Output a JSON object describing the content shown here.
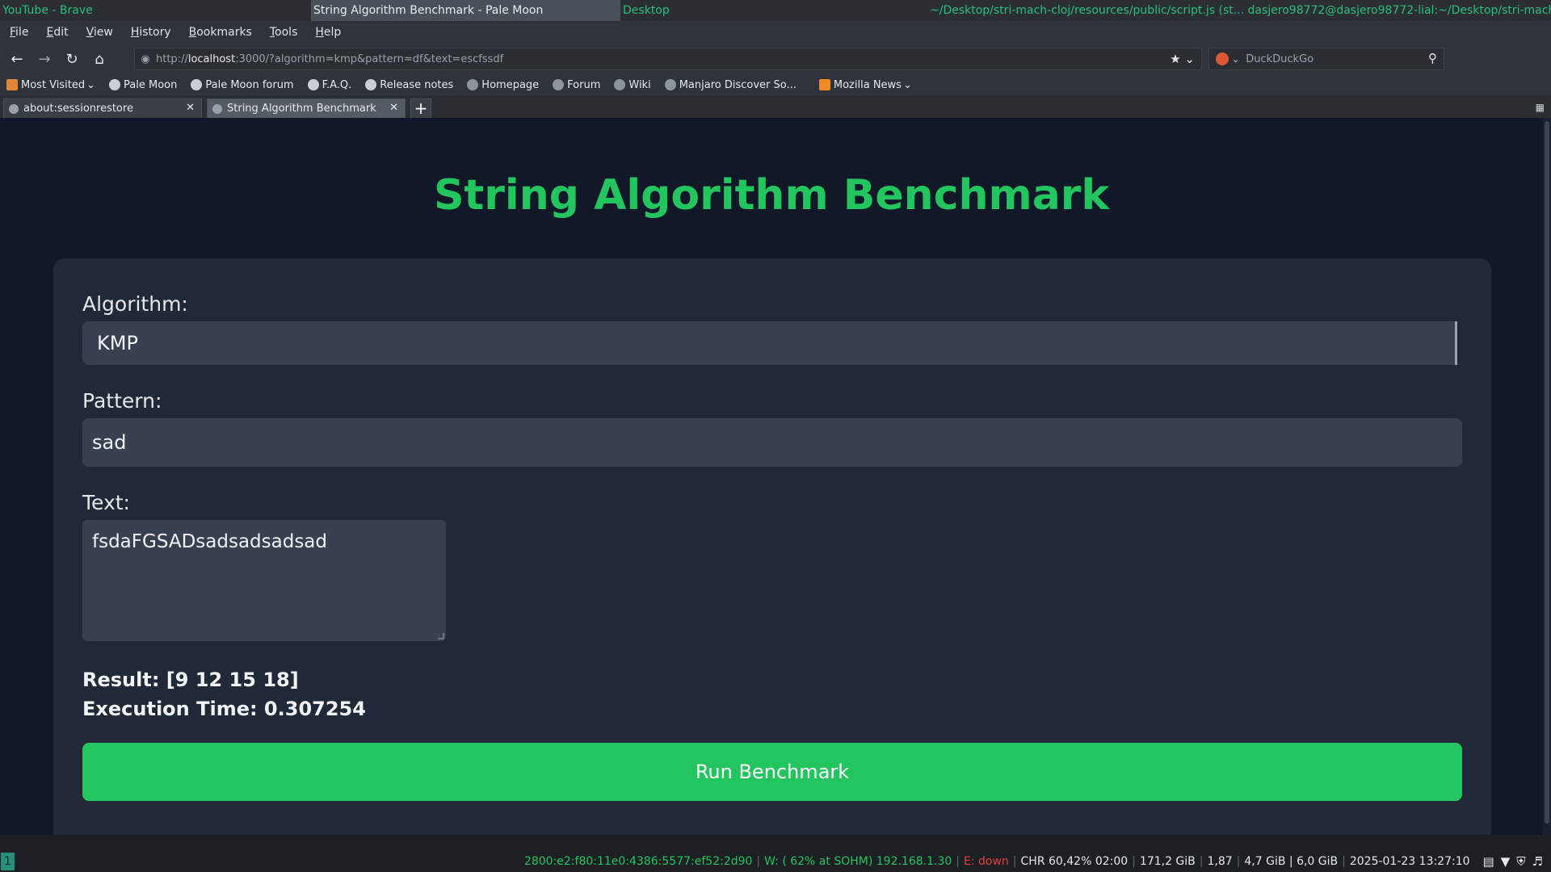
{
  "wm": {
    "windows": [
      "YouTube - Brave",
      "String Algorithm Benchmark - Pale Moon",
      "Desktop",
      "~/Desktop/stri-mach-cloj/resources/public/script.js (st...   dasjero98772@dasjero98772-lial:~/Desktop/stri-mach..."
    ]
  },
  "menu": [
    "File",
    "Edit",
    "View",
    "History",
    "Bookmarks",
    "Tools",
    "Help"
  ],
  "nav": {
    "url_prefix": "http://",
    "url_host": "localhost",
    "url_rest": ":3000/?algorithm=kmp&pattern=df&text=escfssdf",
    "search_placeholder": "DuckDuckGo"
  },
  "bookmarks": [
    "Most Visited",
    "Pale Moon",
    "Pale Moon forum",
    "F.A.Q.",
    "Release notes",
    "Homepage",
    "Forum",
    "Wiki",
    "Manjaro Discover So...",
    "Mozilla News"
  ],
  "tabs": [
    "about:sessionrestore",
    "String Algorithm Benchmark"
  ],
  "page": {
    "title": "String Algorithm Benchmark",
    "algorithm_label": "Algorithm:",
    "algorithm_value": "KMP",
    "pattern_label": "Pattern:",
    "pattern_value": "sad",
    "text_label": "Text:",
    "text_value": "fsdaFGSADsadsadsadsad",
    "result": "Result: [9 12 15 18]",
    "execution_time": "Execution Time: 0.307254",
    "run_button": "Run Benchmark"
  },
  "status": {
    "workspace": "1",
    "ipv6": "2800:e2:f80:11e0:4386:5577:ef52:2d90",
    "wifi": "W: ( 62% at SOHM) 192.168.1.30",
    "eth": "E: down",
    "battery": "CHR 60,42% 02:00",
    "disk": "171,2 GiB",
    "load": "1,87",
    "mem": "4,7 GiB | 6,0 GiB",
    "datetime": "2025-01-23 13:27:10"
  },
  "colors": {
    "accent": "#22c55e",
    "page_bg": "#111827",
    "card_bg": "#1f2937",
    "field_bg": "#374151"
  }
}
